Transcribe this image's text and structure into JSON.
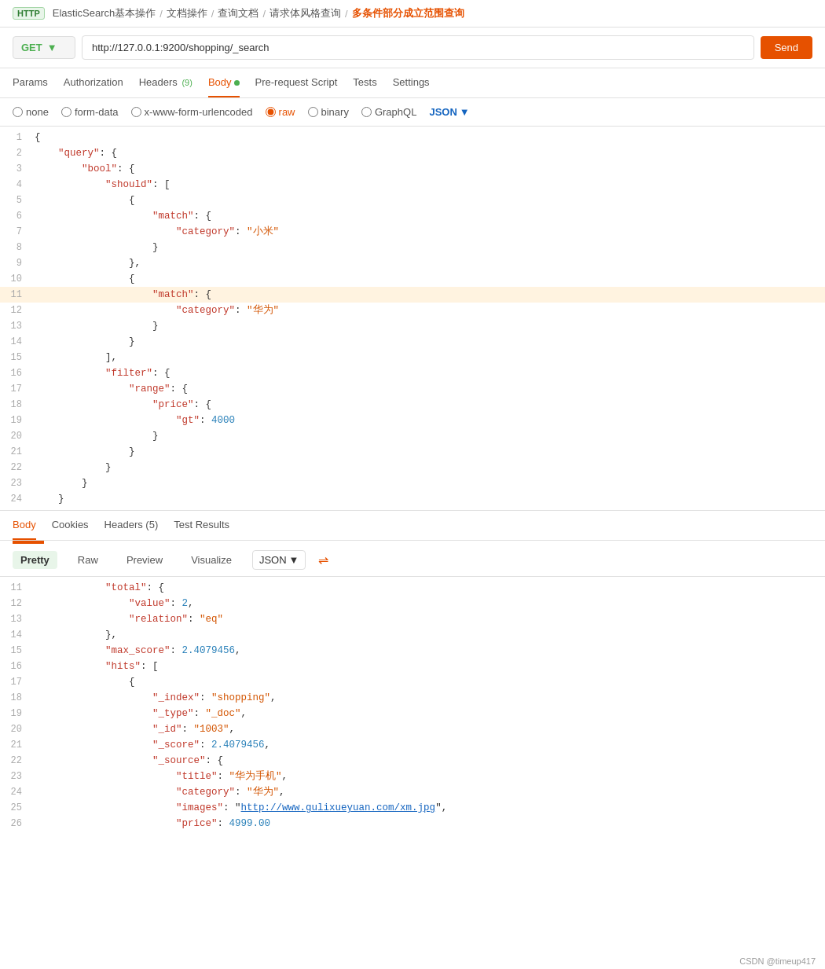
{
  "breadcrumb": {
    "items": [
      {
        "label": "ElasticSearch基本操作",
        "active": false
      },
      {
        "label": "文档操作",
        "active": false
      },
      {
        "label": "查询文档",
        "active": false
      },
      {
        "label": "请求体风格查询",
        "active": false
      },
      {
        "label": "多条件部分成立范围查询",
        "active": true
      }
    ],
    "http_badge": "HTTP"
  },
  "url_bar": {
    "method": "GET",
    "url": "http://127.0.0.1:9200/shopping/_search",
    "send_label": "Send"
  },
  "request_tabs": [
    {
      "label": "Params",
      "active": false
    },
    {
      "label": "Authorization",
      "active": false
    },
    {
      "label": "Headers (9)",
      "active": false
    },
    {
      "label": "Body",
      "active": true,
      "has_dot": true
    },
    {
      "label": "Pre-request Script",
      "active": false
    },
    {
      "label": "Tests",
      "active": false
    },
    {
      "label": "Settings",
      "active": false
    }
  ],
  "body_options": [
    {
      "label": "none",
      "value": "none",
      "selected": false
    },
    {
      "label": "form-data",
      "value": "form-data",
      "selected": false
    },
    {
      "label": "x-www-form-urlencoded",
      "value": "x-www-form-urlencoded",
      "selected": false
    },
    {
      "label": "raw",
      "value": "raw",
      "selected": true
    },
    {
      "label": "binary",
      "value": "binary",
      "selected": false
    },
    {
      "label": "GraphQL",
      "value": "graphql",
      "selected": false
    }
  ],
  "json_label": "JSON",
  "request_code_lines": [
    {
      "num": 1,
      "content": "{",
      "highlighted": false
    },
    {
      "num": 2,
      "content": "    \"query\": {",
      "highlighted": false
    },
    {
      "num": 3,
      "content": "        \"bool\": {",
      "highlighted": false
    },
    {
      "num": 4,
      "content": "            \"should\": [",
      "highlighted": false
    },
    {
      "num": 5,
      "content": "                {",
      "highlighted": false
    },
    {
      "num": 6,
      "content": "                    \"match\": {",
      "highlighted": false
    },
    {
      "num": 7,
      "content": "                        \"category\": \"小米\"",
      "highlighted": false
    },
    {
      "num": 8,
      "content": "                    }",
      "highlighted": false
    },
    {
      "num": 9,
      "content": "                },",
      "highlighted": false
    },
    {
      "num": 10,
      "content": "                {",
      "highlighted": false
    },
    {
      "num": 11,
      "content": "                    \"match\": {|",
      "highlighted": true
    },
    {
      "num": 12,
      "content": "                        \"category\": \"华为\"",
      "highlighted": false
    },
    {
      "num": 13,
      "content": "                    }",
      "highlighted": false
    },
    {
      "num": 14,
      "content": "                }",
      "highlighted": false
    },
    {
      "num": 15,
      "content": "            ],",
      "highlighted": false
    },
    {
      "num": 16,
      "content": "            \"filter\": {",
      "highlighted": false
    },
    {
      "num": 17,
      "content": "                \"range\": {",
      "highlighted": false
    },
    {
      "num": 18,
      "content": "                    \"price\": {",
      "highlighted": false
    },
    {
      "num": 19,
      "content": "                        \"gt\": 4000",
      "highlighted": false
    },
    {
      "num": 20,
      "content": "                    }",
      "highlighted": false
    },
    {
      "num": 21,
      "content": "                }",
      "highlighted": false
    },
    {
      "num": 22,
      "content": "            }",
      "highlighted": false
    },
    {
      "num": 23,
      "content": "        }",
      "highlighted": false
    },
    {
      "num": 24,
      "content": "    }",
      "highlighted": false
    }
  ],
  "response_tabs": [
    {
      "label": "Body",
      "active": true
    },
    {
      "label": "Cookies",
      "active": false
    },
    {
      "label": "Headers (5)",
      "active": false
    },
    {
      "label": "Test Results",
      "active": false
    }
  ],
  "response_format_buttons": [
    {
      "label": "Pretty",
      "active": true
    },
    {
      "label": "Raw",
      "active": false
    },
    {
      "label": "Preview",
      "active": false
    },
    {
      "label": "Visualize",
      "active": false
    }
  ],
  "response_json_label": "JSON",
  "response_code_lines": [
    {
      "num": 11,
      "content": "            \"total\": {"
    },
    {
      "num": 12,
      "content": "                \"value\": 2,"
    },
    {
      "num": 13,
      "content": "                \"relation\": \"eq\""
    },
    {
      "num": 14,
      "content": "            },"
    },
    {
      "num": 15,
      "content": "            \"max_score\": 2.4079456,"
    },
    {
      "num": 16,
      "content": "            \"hits\": ["
    },
    {
      "num": 17,
      "content": "                {"
    },
    {
      "num": 18,
      "content": "                    \"_index\": \"shopping\","
    },
    {
      "num": 19,
      "content": "                    \"_type\": \"_doc\","
    },
    {
      "num": 20,
      "content": "                    \"_id\": \"1003\","
    },
    {
      "num": 21,
      "content": "                    \"_score\": 2.4079456,"
    },
    {
      "num": 22,
      "content": "                    \"_source\": {"
    },
    {
      "num": 23,
      "content": "                        \"title\": \"华为手机\","
    },
    {
      "num": 24,
      "content": "                        \"category\": \"华为\","
    },
    {
      "num": 25,
      "content": "                        \"images\": \"http://www.gulixueyuan.com/xm.jpg\","
    },
    {
      "num": 26,
      "content": "                        \"price\": 4999.00"
    }
  ],
  "footer": {
    "text": "CSDN @timeup417"
  }
}
